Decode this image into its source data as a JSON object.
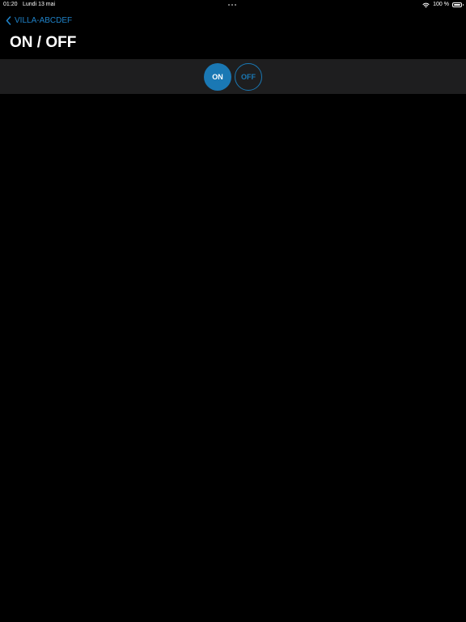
{
  "status_bar": {
    "time": "01:20",
    "date": "Lundi 13 mai",
    "battery": "100 %",
    "icons": [
      "more-dots-icon",
      "wifi-icon",
      "battery-icon"
    ]
  },
  "nav": {
    "back_label": "VILLA-ABCDEF",
    "back_icon": "chevron-left-icon"
  },
  "page": {
    "title": "ON / OFF"
  },
  "toggle": {
    "on_label": "ON",
    "off_label": "OFF",
    "selected": "ON"
  },
  "colors": {
    "background": "#000000",
    "toolbar": "#1e1e1f",
    "accent": "#1a78b4",
    "text": "#ffffff"
  }
}
